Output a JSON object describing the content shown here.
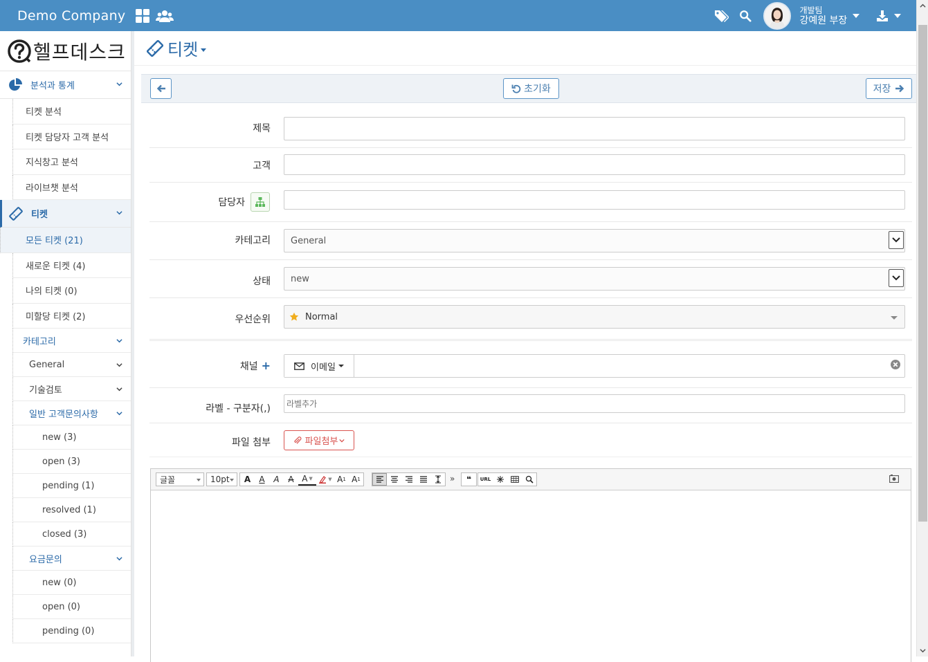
{
  "topbar": {
    "brand": "Demo Company",
    "user_team": "개발팀",
    "user_name": "강예원 부장",
    "help": "?"
  },
  "sidebar": {
    "logo_text": "헬프데스크",
    "sections": [
      {
        "label": "분석과 통계",
        "icon": "pie-chart-icon"
      },
      {
        "label": "티켓",
        "icon": "ticket-icon"
      }
    ],
    "analytics_items": [
      "티켓 분석",
      "티켓 담당자 고객 분석",
      "지식창고 분석",
      "라이브챗 분석"
    ],
    "ticket_items": [
      "모든 티켓 (21)",
      "새로운 티켓 (4)",
      "나의 티켓 (0)",
      "미할당 티켓 (2)"
    ],
    "category": {
      "label": "카테고리",
      "groups": [
        "General",
        "기술검토",
        "일반 고객문의사항",
        "요금문의"
      ],
      "general_inquiry_items": [
        "new (3)",
        "open (3)",
        "pending (1)",
        "resolved (1)",
        "closed (3)"
      ],
      "billing_items": [
        "new (0)",
        "open (0)",
        "pending (0)"
      ]
    }
  },
  "page": {
    "title": "티켓"
  },
  "toolbar": {
    "reset_label": "초기화",
    "save_label": "저장"
  },
  "form": {
    "subject_label": "제목",
    "customer_label": "고객",
    "assignee_label": "담당자",
    "category_label": "카테고리",
    "category_value": "General",
    "status_label": "상태",
    "status_value": "new",
    "priority_label": "우선순위",
    "priority_value": "Normal",
    "channel_label": "채널",
    "channel_value": "이메일",
    "labels_label": "라벨 - 구분자(,)",
    "labels_placeholder": "라벨추가",
    "attach_label": "파일 첨부",
    "attach_button": "파일첨부"
  },
  "editor": {
    "font_select": "글꼴",
    "size_select": "10pt",
    "quote_glyph": "❝",
    "url_label": "URL"
  },
  "colors": {
    "topbar": "#4a8ec4",
    "accent": "#2b6aa8",
    "danger": "#d9534f",
    "star": "#f0ad1d"
  }
}
